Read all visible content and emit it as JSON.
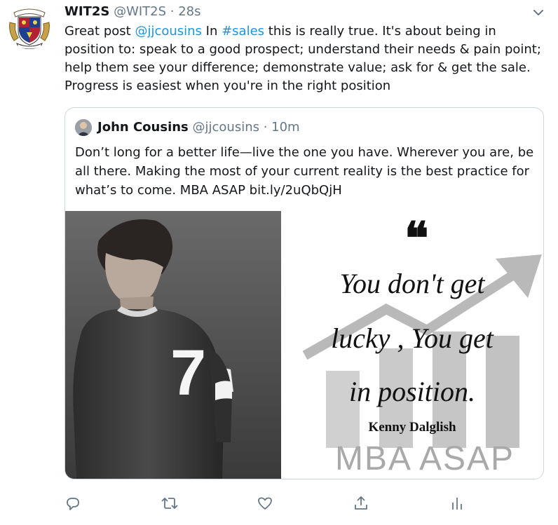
{
  "tweet": {
    "display_name": "WIT2S",
    "handle": "@WIT2S",
    "separator": " · ",
    "time": "28s",
    "text": {
      "t1": "Great post ",
      "mention": "@jjcousins",
      "t2": " In ",
      "hashtag": "#sales",
      "t3": " this is really true.  It's about being in position to: speak to a good prospect; understand their needs & pain point; help them see your difference; demonstrate value; ask for & get the sale. Progress is easiest when you're in the right position"
    }
  },
  "quoted": {
    "display_name": "John Cousins",
    "handle": "@jjcousins",
    "separator": " · ",
    "time": "10m",
    "text": "Don’t long for a better life—live the one you have. Wherever you are, be all there. Making the most of your current reality is the best practice for what’s to come.  MBA ASAP  bit.ly/2uQbQjH",
    "image": {
      "jersey_number": "7",
      "quote_mark": "❝",
      "quote_lines": [
        "You don't get",
        "lucky , You get",
        "in position."
      ],
      "author": "Kenny Dalglish",
      "brand": "MBA ASAP"
    }
  },
  "icons": {
    "avatar": "crest-avatar-icon",
    "menu": "chevron-down-icon",
    "reply": "reply-icon",
    "retweet": "retweet-icon",
    "like": "heart-icon",
    "share": "share-icon",
    "analytics": "analytics-icon"
  },
  "colors": {
    "link": "#1b95e0",
    "muted": "#657786",
    "border": "#ccd6dd"
  }
}
